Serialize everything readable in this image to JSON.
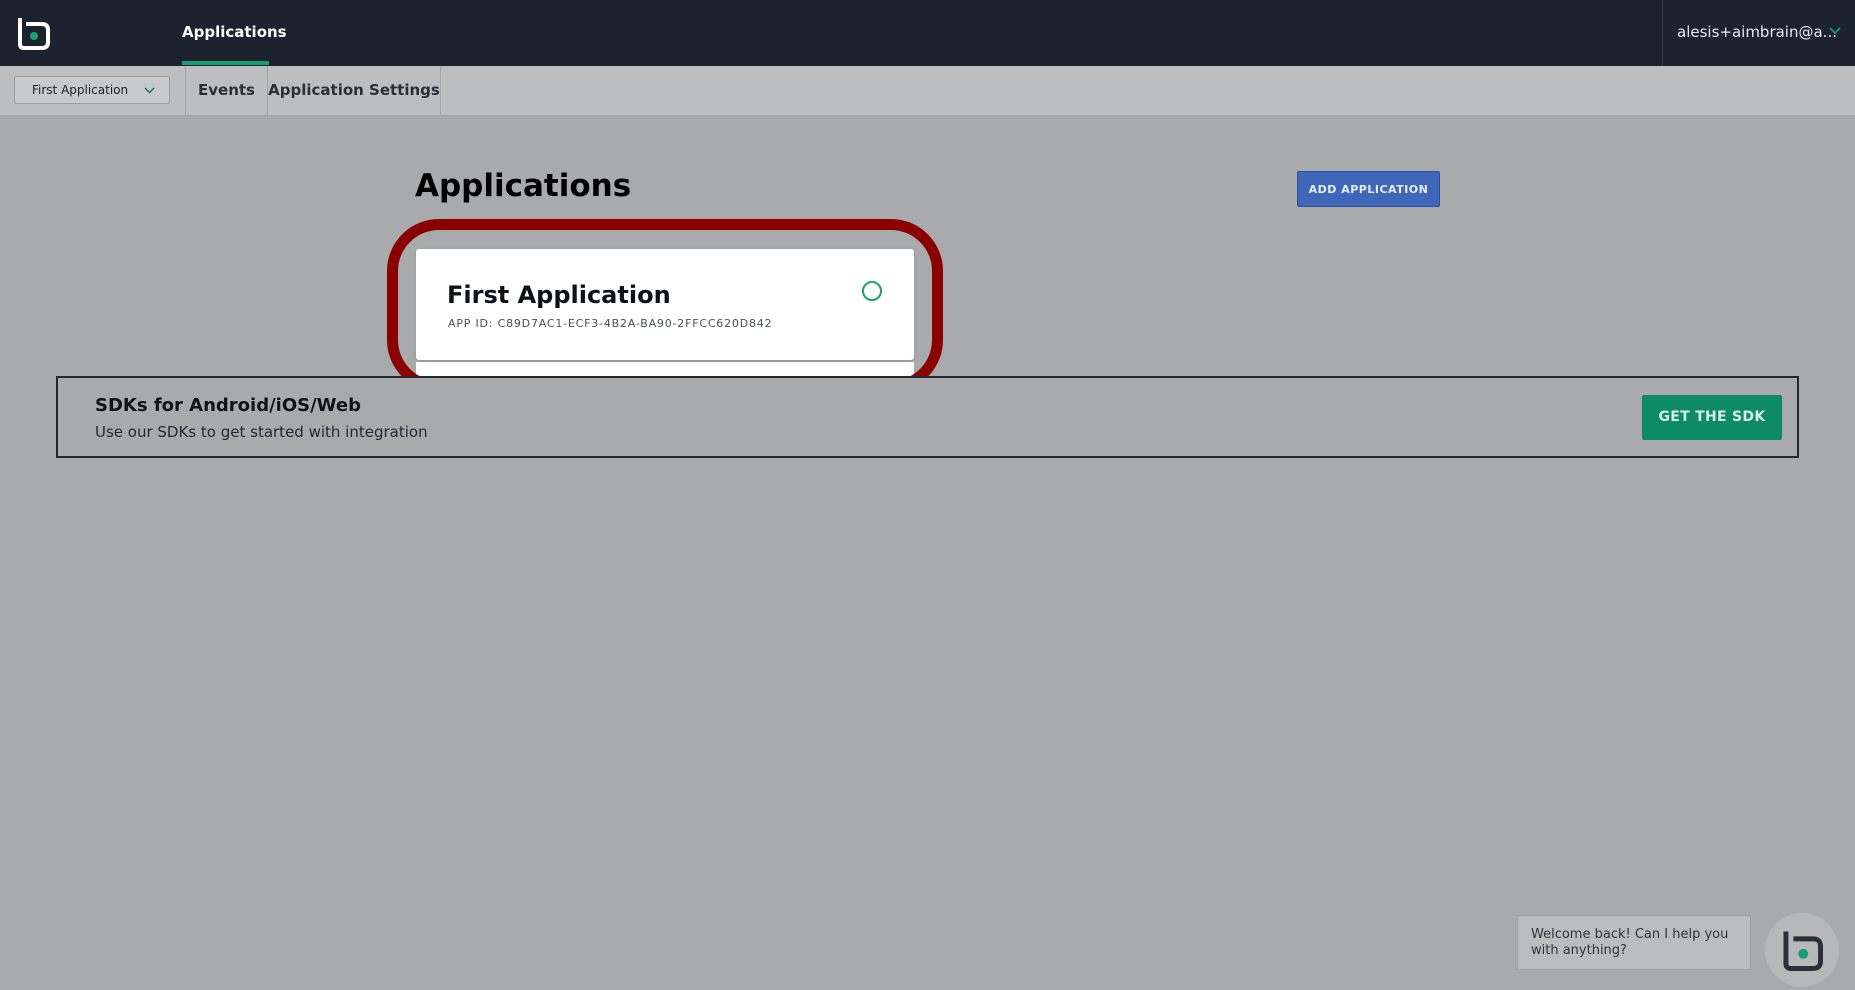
{
  "header": {
    "logo_icon": "aimbrain-logo-icon",
    "nav_tab": "Applications",
    "user_email": "alesis+aimbrain@a...",
    "accent": "#17a06f"
  },
  "subnav": {
    "app_select_value": "First Application",
    "tabs": [
      {
        "label": "Events"
      },
      {
        "label": "Application Settings"
      }
    ]
  },
  "main": {
    "title": "Applications",
    "add_button": "ADD APPLICATION",
    "applications": [
      {
        "name": "First Application",
        "app_id": "APP ID: C89D7AC1-ECF3-4B2A-BA90-2FFCC620D842",
        "status_icon": "status-circle-icon"
      }
    ],
    "highlight_color": "#8b0000"
  },
  "sdk_banner": {
    "title": "SDKs for Android/iOS/Web",
    "subtitle": "Use our SDKs to get started with integration",
    "button": "GET THE SDK",
    "button_color": "#0d8c63"
  },
  "chat": {
    "message": "Welcome back! Can I help you with anything?",
    "launcher_icon": "aimbrain-logo-icon"
  }
}
